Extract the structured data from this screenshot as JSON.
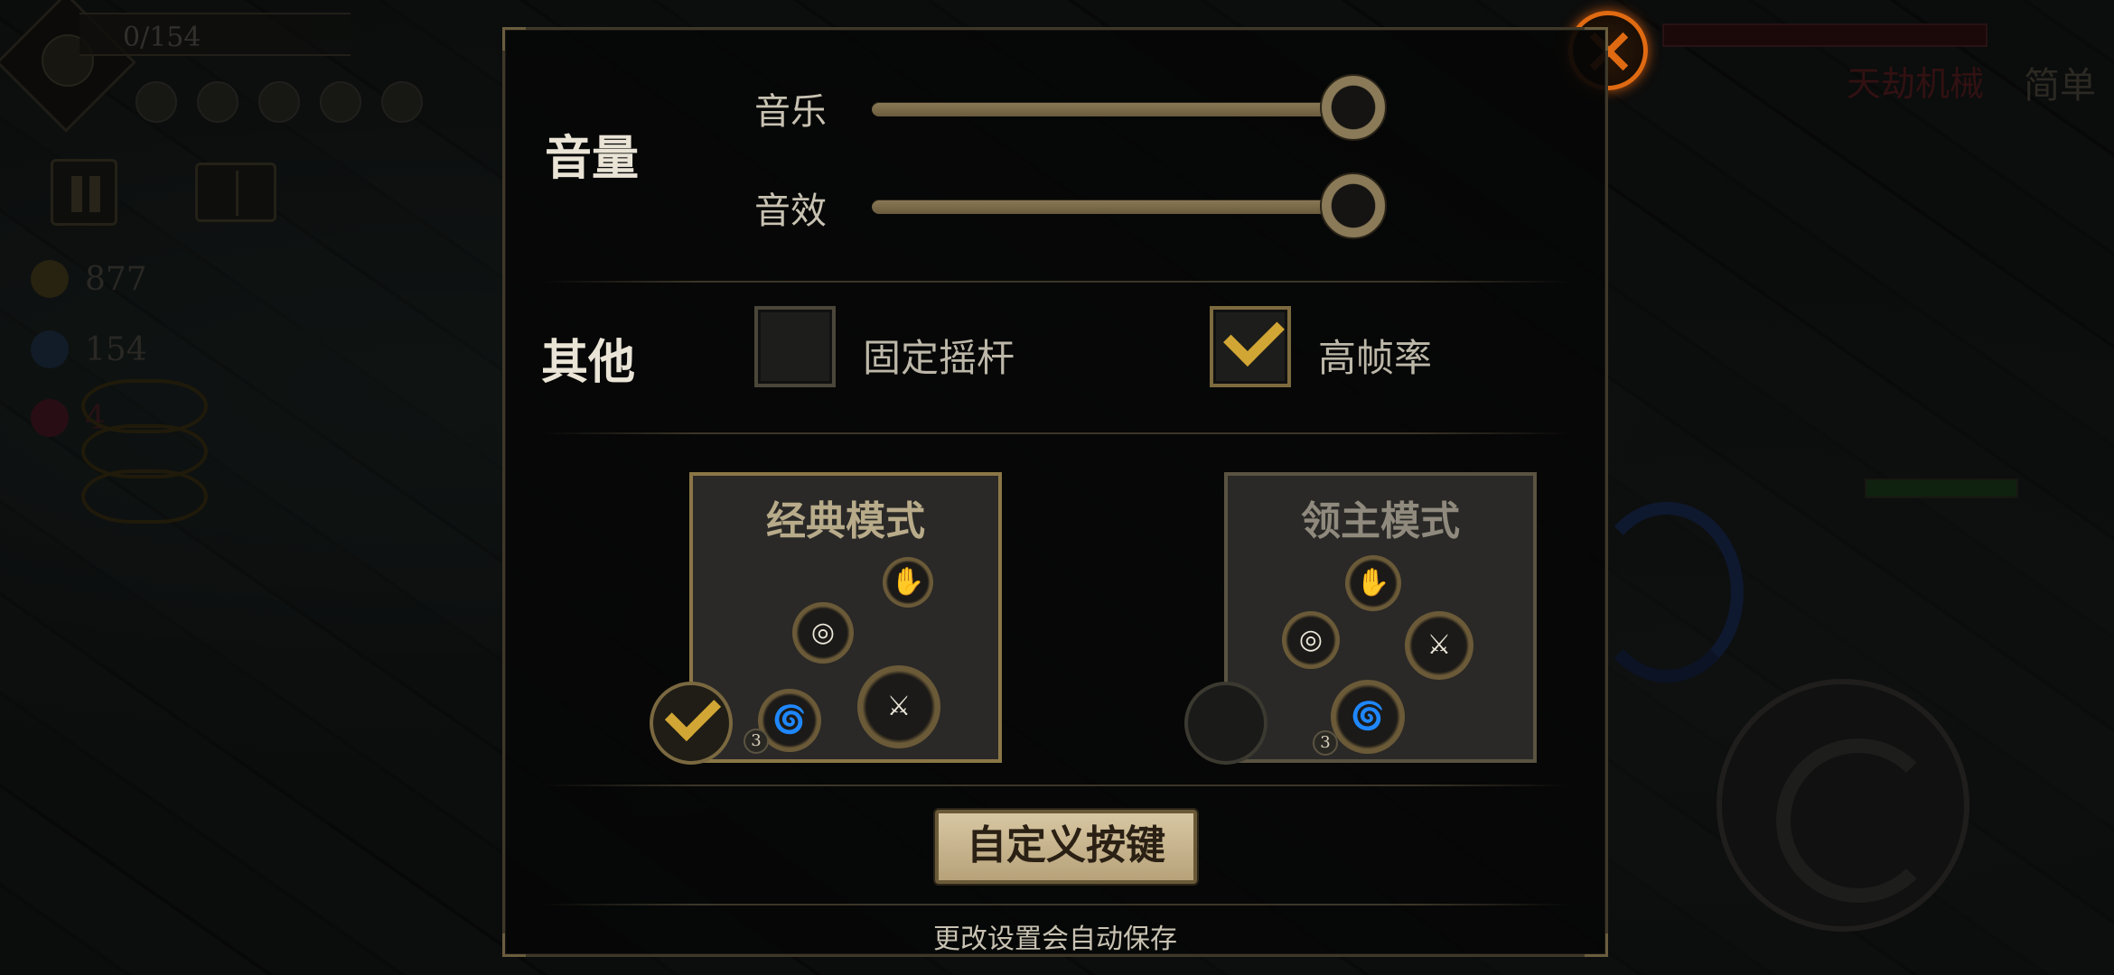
{
  "hud": {
    "progress": "0/154",
    "gold": "877",
    "gems": "154",
    "keys": "4",
    "boss_name": "天劫机械",
    "difficulty": "简单"
  },
  "settings": {
    "volume": {
      "section_label": "音量",
      "music_label": "音乐",
      "music_level": 1.0,
      "sfx_label": "音效",
      "sfx_level": 1.0
    },
    "other": {
      "section_label": "其他",
      "fixed_joystick": {
        "label": "固定摇杆",
        "checked": false
      },
      "high_framerate": {
        "label": "高帧率",
        "checked": true
      }
    },
    "modes": [
      {
        "title": "经典模式",
        "selected": true,
        "skill_count": "3"
      },
      {
        "title": "领主模式",
        "selected": false,
        "skill_count": "3"
      }
    ],
    "custom_keys_label": "自定义按键",
    "autosave_note": "更改设置会自动保存"
  },
  "colors": {
    "accent_gold": "#d2a634",
    "close_orange": "#e06a12"
  }
}
